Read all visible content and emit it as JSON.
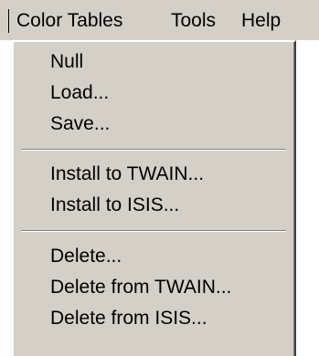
{
  "menubar": {
    "items": [
      {
        "label": "Color Tables"
      },
      {
        "label": "Tools"
      },
      {
        "label": "Help"
      }
    ]
  },
  "dropdown": {
    "groups": [
      [
        "Null",
        "Load...",
        "Save..."
      ],
      [
        "Install to TWAIN...",
        "Install to ISIS..."
      ],
      [
        "Delete...",
        "Delete from TWAIN...",
        "Delete from ISIS..."
      ]
    ]
  },
  "colors": {
    "menu_face": "#d4d0c8",
    "text": "#000000",
    "separator_dark": "#808080",
    "separator_light": "#ffffff"
  }
}
